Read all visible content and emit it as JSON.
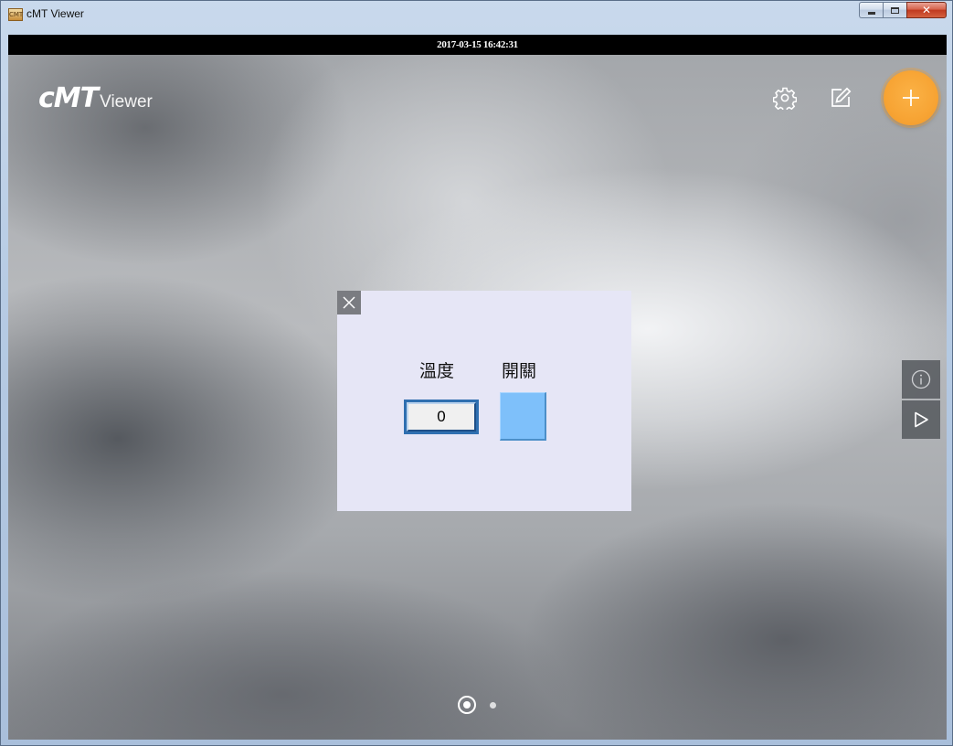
{
  "window": {
    "title": "cMT Viewer",
    "app_icon_text": "CMT"
  },
  "timebar": {
    "datetime": "2017-03-15 16:42:31"
  },
  "header": {
    "logo_main": "cMT",
    "logo_sub": "Viewer",
    "icons": {
      "settings": "gear-icon",
      "edit": "edit-icon",
      "add": "plus-icon"
    },
    "add_button_color": "#f7a434"
  },
  "popup": {
    "background": "#e6e6f6",
    "labels": {
      "temperature": "溫度",
      "switch": "開關"
    },
    "numeric_value": "0",
    "switch_color": "#7ec0fa"
  },
  "side_buttons": {
    "info": "info-icon",
    "play": "play-icon"
  },
  "pager": {
    "pages": 2,
    "current_page": 1
  }
}
